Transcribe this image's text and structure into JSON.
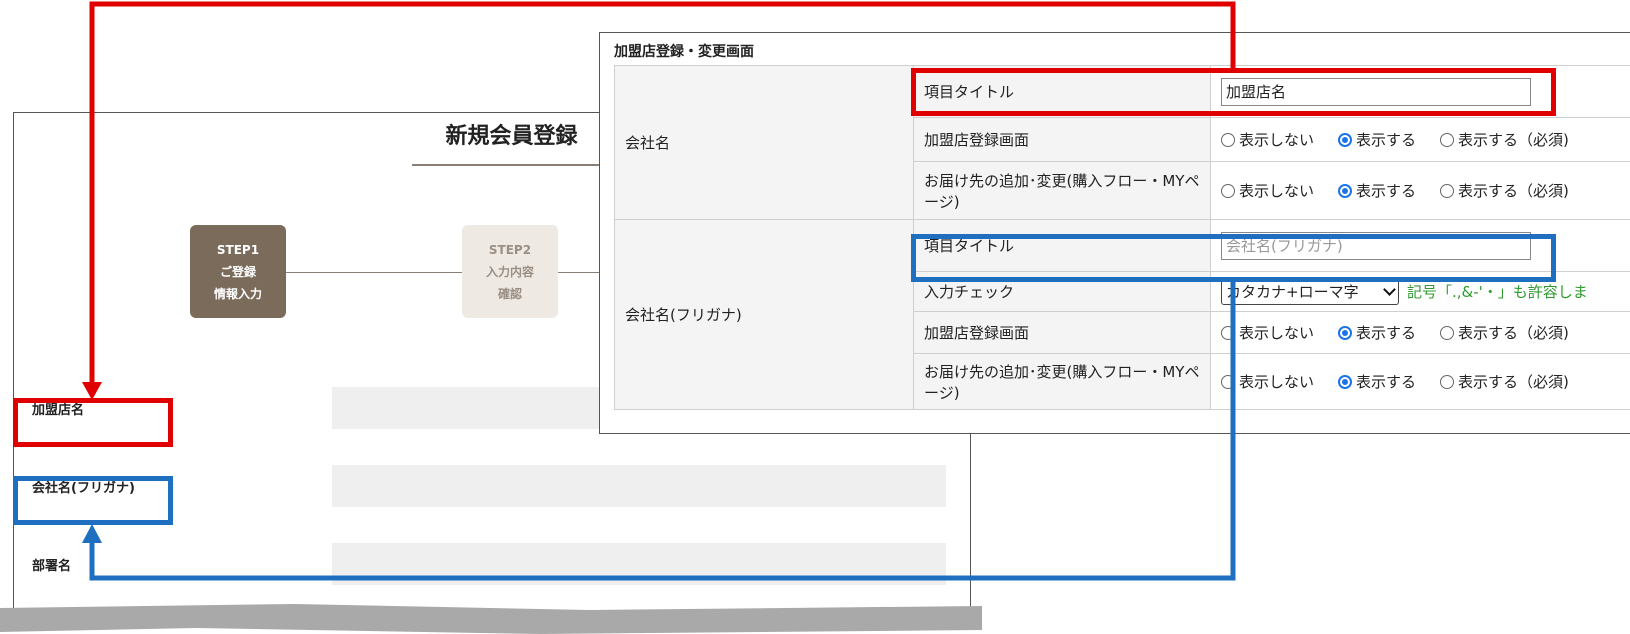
{
  "form": {
    "title": "新規会員登録",
    "steps": [
      {
        "line1": "STEP1",
        "line2": "ご登録",
        "line3": "情報入力",
        "state": "active"
      },
      {
        "line1": "STEP2",
        "line2": "入力内容",
        "line3": "確認",
        "state": "inactive"
      }
    ],
    "fields": [
      {
        "label": "加盟店名"
      },
      {
        "label": "会社名(フリガナ)"
      },
      {
        "label": "部署名"
      }
    ]
  },
  "admin": {
    "title": "加盟店登録・変更画面",
    "groups": [
      {
        "name": "会社名",
        "rows": [
          {
            "item": "項目タイトル",
            "input_value": "加盟店名"
          },
          {
            "item": "加盟店登録画面",
            "options": [
              "表示しない",
              "表示する",
              "表示する（必須)"
            ],
            "selected": 1
          },
          {
            "item": "お届け先の追加･変更(購入フロー・MYページ)",
            "options": [
              "表示しない",
              "表示する",
              "表示する（必須)"
            ],
            "selected": 1
          }
        ]
      },
      {
        "name": "会社名(フリガナ)",
        "rows": [
          {
            "item": "項目タイトル",
            "input_placeholder": "会社名(フリガナ)"
          },
          {
            "item": "入力チェック",
            "select_value": "カタカナ+ローマ字",
            "hint": "記号「.,&-'・」も許容しま"
          },
          {
            "item": "加盟店登録画面",
            "options": [
              "表示しない",
              "表示する",
              "表示する（必須)"
            ],
            "selected": 1
          },
          {
            "item": "お届け先の追加･変更(購入フロー・MYページ)",
            "options": [
              "表示しない",
              "表示する",
              "表示する（必須)"
            ],
            "selected": 1
          }
        ]
      }
    ]
  },
  "colors": {
    "red_callout": "#e10000",
    "blue_callout": "#1f6fc0",
    "step_active": "#7b6b5b",
    "step_inactive": "#efe9e3",
    "hint": "#2e9b2e"
  }
}
